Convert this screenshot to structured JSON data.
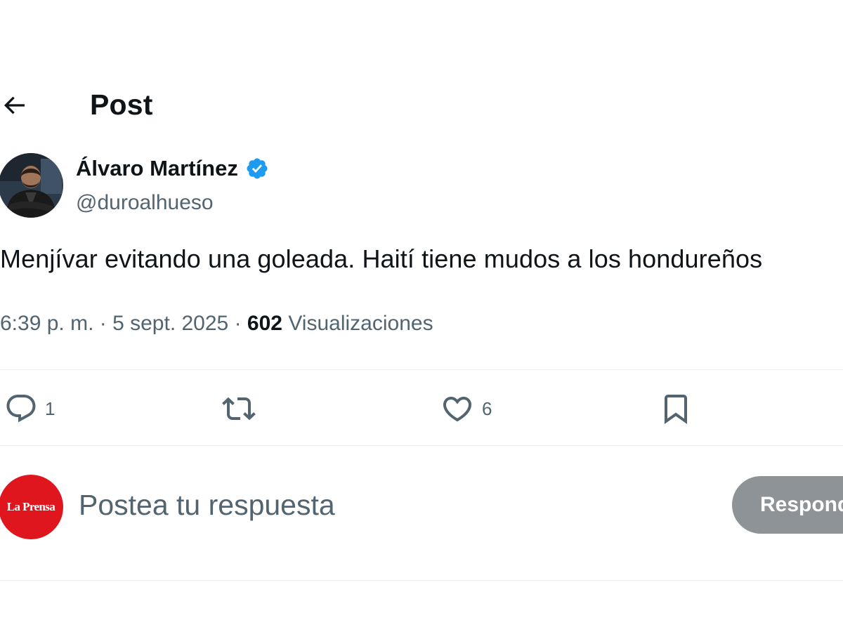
{
  "header": {
    "title": "Post"
  },
  "author": {
    "display_name": "Álvaro Martínez",
    "handle": "@duroalhueso",
    "verified": true
  },
  "post": {
    "text": "Menjívar evitando una goleada. Haití tiene mudos a los hondureños",
    "time": "6:39 p. m.",
    "separator": "·",
    "date": "5 sept. 2025",
    "views_count": "602",
    "views_label": "Visualizaciones"
  },
  "actions": {
    "reply_count": "1",
    "like_count": "6"
  },
  "reply_box": {
    "avatar_text": "La Prensa",
    "placeholder": "Postea tu respuesta",
    "button_label": "Responder"
  },
  "colors": {
    "verified_badge": "#1d9bf0",
    "secondary_text": "#536471",
    "reply_avatar_bg": "#e0161f",
    "disabled_button": "#8e9398",
    "divider": "#eff3f4"
  },
  "icons": {
    "back": "arrow-left-icon",
    "verified": "verified-badge-icon",
    "reply": "reply-icon",
    "repost": "repost-icon",
    "like": "heart-icon",
    "bookmark": "bookmark-icon"
  }
}
